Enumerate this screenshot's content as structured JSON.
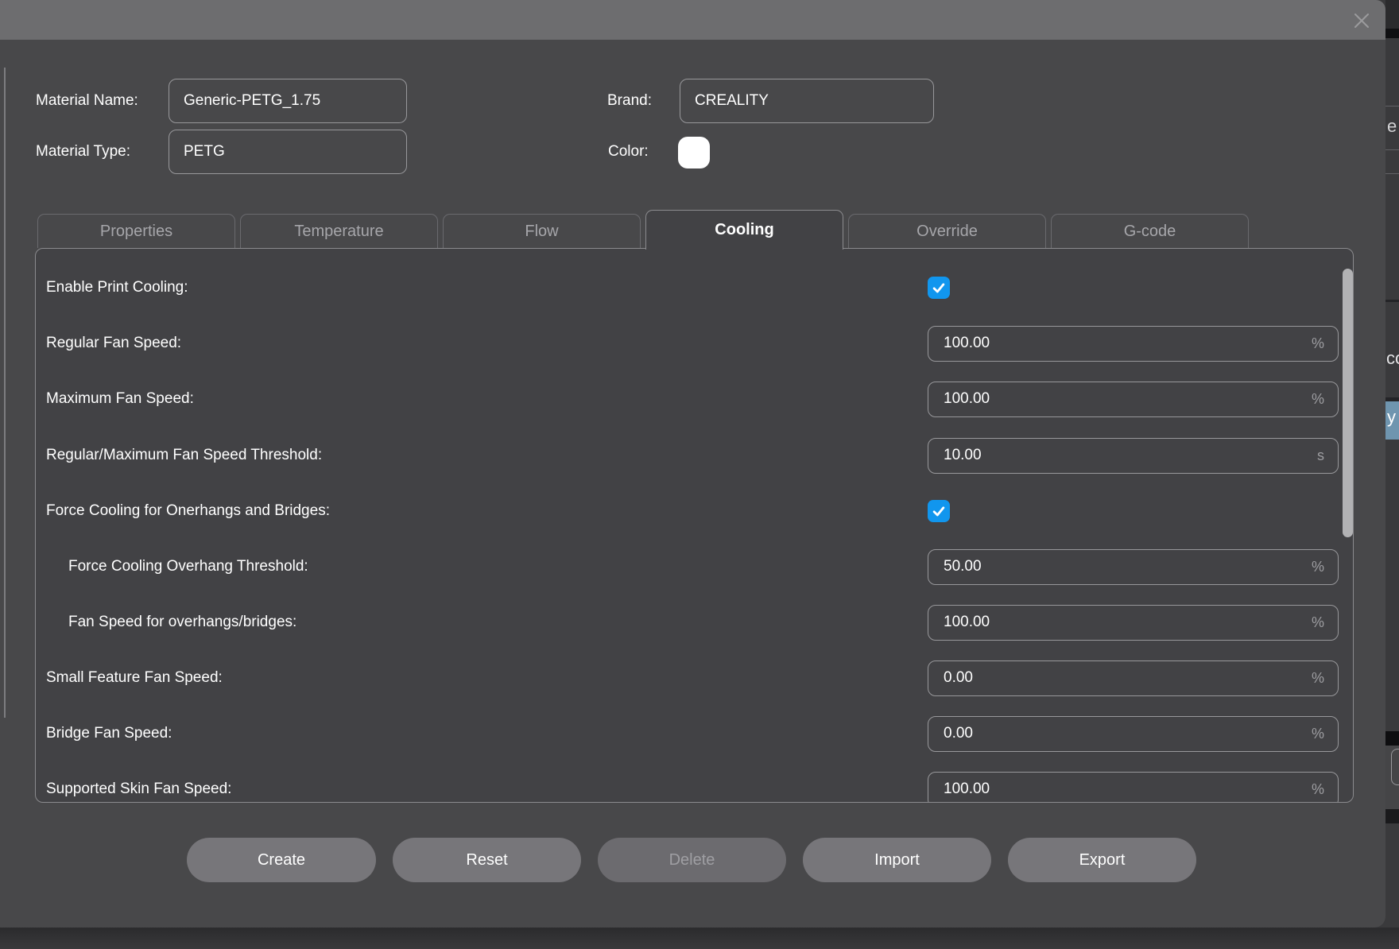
{
  "window": {
    "kind": "material-editor-dialog",
    "close_icon": "x"
  },
  "header": {
    "material_name": {
      "label": "Material Name:",
      "value": "Generic-PETG_1.75"
    },
    "material_type": {
      "label": "Material Type:",
      "value": "PETG"
    },
    "brand": {
      "label": "Brand:",
      "value": "CREALITY"
    },
    "color": {
      "label": "Color:",
      "swatch_color": "#ffffff"
    }
  },
  "tabs": [
    {
      "label": "Properties",
      "active": false
    },
    {
      "label": "Temperature",
      "active": false
    },
    {
      "label": "Flow",
      "active": false
    },
    {
      "label": "Cooling",
      "active": true
    },
    {
      "label": "Override",
      "active": false
    },
    {
      "label": "G-code",
      "active": false
    }
  ],
  "settings": {
    "rows": [
      {
        "label": "Enable Print Cooling:",
        "type": "checkbox",
        "checked": true
      },
      {
        "label": "Regular Fan Speed:",
        "type": "number",
        "value": "100.00",
        "unit": "%"
      },
      {
        "label": "Maximum Fan Speed:",
        "type": "number",
        "value": "100.00",
        "unit": "%"
      },
      {
        "label": "Regular/Maximum Fan Speed Threshold:",
        "type": "number",
        "value": "10.00",
        "unit": "s"
      },
      {
        "label": "Force Cooling for Onerhangs and Bridges:",
        "type": "checkbox",
        "checked": true
      },
      {
        "label": "Force Cooling Overhang Threshold:",
        "type": "number",
        "value": "50.00",
        "unit": "%",
        "indent": true
      },
      {
        "label": "Fan Speed for overhangs/bridges:",
        "type": "number",
        "value": "100.00",
        "unit": "%",
        "indent": true
      },
      {
        "label": "Small Feature Fan Speed:",
        "type": "number",
        "value": "0.00",
        "unit": "%"
      },
      {
        "label": "Bridge Fan Speed:",
        "type": "number",
        "value": "0.00",
        "unit": "%"
      },
      {
        "label": "Supported Skin Fan Speed:",
        "type": "number",
        "value": "100.00",
        "unit": "%"
      }
    ]
  },
  "buttons": [
    {
      "label": "Create",
      "disabled": false
    },
    {
      "label": "Reset",
      "disabled": false
    },
    {
      "label": "Delete",
      "disabled": true
    },
    {
      "label": "Import",
      "disabled": false
    },
    {
      "label": "Export",
      "disabled": false
    }
  ],
  "background_window": {
    "partial_texts": [
      {
        "text": "e"
      },
      {
        "text": "co"
      },
      {
        "text": "y"
      }
    ],
    "selected_row_color": "#6f95af"
  },
  "colors": {
    "accent_checkbox": "#1196ee",
    "dialog_bg": "#48484a",
    "titlebar_bg": "#6d6d6f",
    "panel_bg": "#424245",
    "swatch": "#ffffff"
  }
}
